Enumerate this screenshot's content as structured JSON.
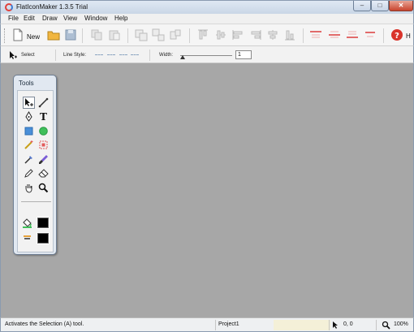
{
  "window": {
    "title": "FlatIconMaker 1.3.5 Trial",
    "minimize_glyph": "–",
    "maximize_glyph": "□",
    "close_glyph": "✕"
  },
  "menu": {
    "items": [
      "File",
      "Edit",
      "Draw",
      "View",
      "Window",
      "Help"
    ]
  },
  "toolbar": {
    "new_label": "New",
    "help_label": "H",
    "help_glyph": "?"
  },
  "properties": {
    "select_label": "Select",
    "line_style_label": "Line Style:",
    "width_label": "Width:",
    "width_value": "1"
  },
  "tools": {
    "title": "Tools",
    "text_tool_glyph": "T",
    "items": [
      "selection-tool",
      "line-tool",
      "pen-tool",
      "text-tool",
      "rectangle-tool",
      "ellipse-tool",
      "magic-wand-tool",
      "transform-tool",
      "eyedropper-tool",
      "brush-tool",
      "pencil-tool",
      "eraser-tool",
      "hand-tool",
      "zoom-tool"
    ],
    "fill_color": "#000000",
    "stroke_color": "#000000"
  },
  "status": {
    "message": "Activates the Selection (A) tool.",
    "project": "Project1",
    "coordinates": "0, 0",
    "zoom": "100%"
  },
  "colors": {
    "canvas": "#a7a7a7",
    "rectangle_tool": "#4a8fd8",
    "ellipse_tool": "#3fbf5a",
    "help": "#d9342b"
  }
}
